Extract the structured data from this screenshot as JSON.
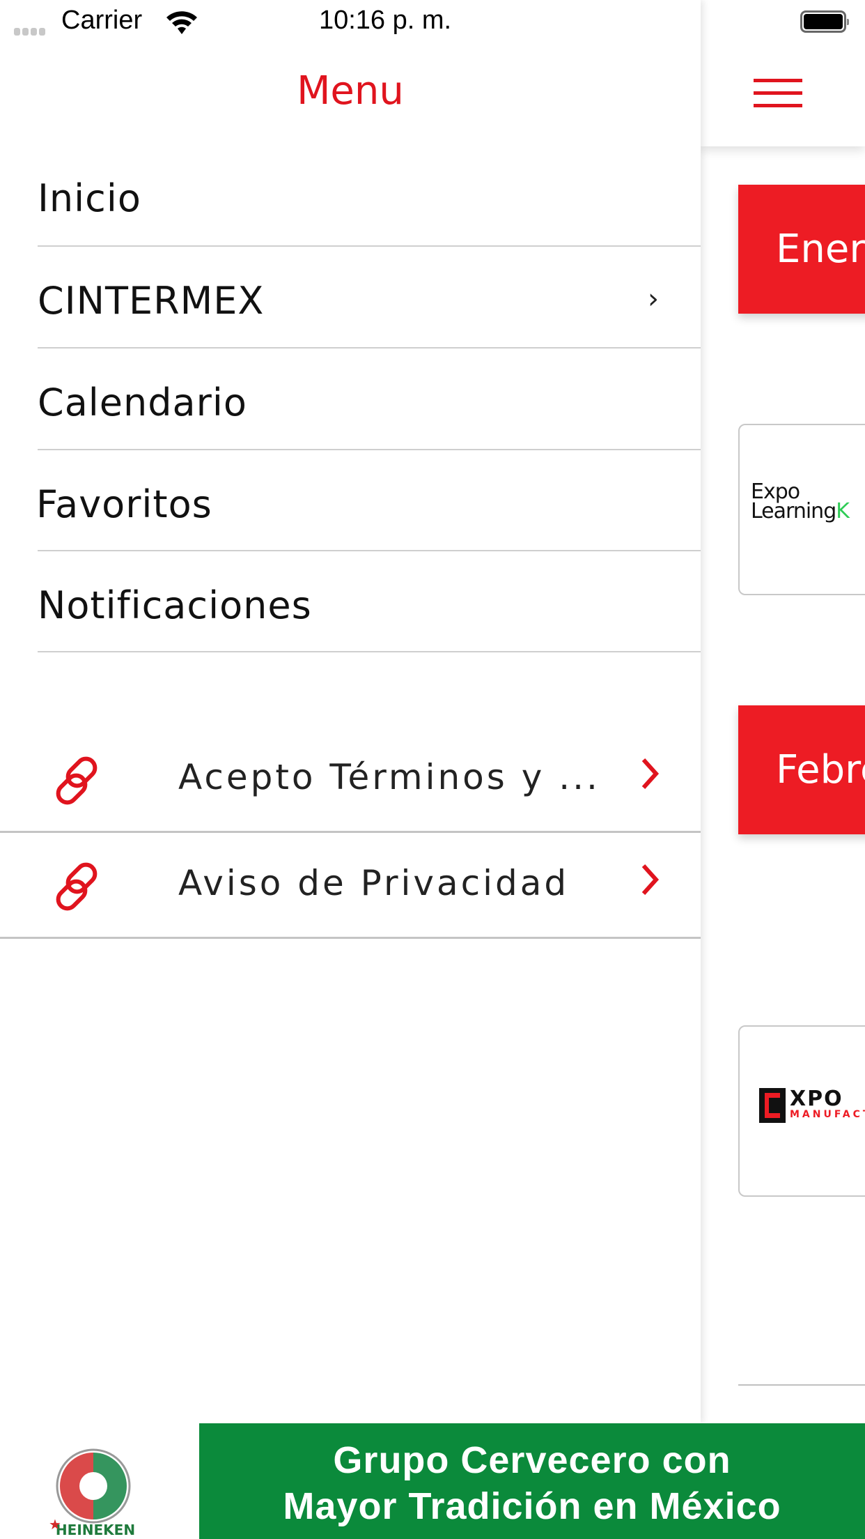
{
  "status_bar": {
    "carrier": "Carrier",
    "time": "10:16 p. m.",
    "signal_icon": "signal-dots-icon",
    "wifi_icon": "wifi-icon",
    "battery_icon": "battery-full-icon"
  },
  "drawer": {
    "title": "Menu",
    "items": [
      {
        "label": "Inicio",
        "has_chevron": false
      },
      {
        "label": "CINTERMEX",
        "has_chevron": true,
        "chevron": "›"
      },
      {
        "label": "Calendario",
        "has_chevron": false
      },
      {
        "label": "Favoritos",
        "has_chevron": false
      },
      {
        "label": "Notificaciones",
        "has_chevron": false
      }
    ],
    "links": [
      {
        "label": "Acepto Términos y ...",
        "icon": "link-icon"
      },
      {
        "label": "Aviso de Privacidad",
        "icon": "link-icon"
      }
    ]
  },
  "content": {
    "menu_icon": "hamburger-icon",
    "months": [
      "Enero",
      "Febrero"
    ],
    "events": [
      {
        "logo_line1": "Expo",
        "logo_line2": "Learning",
        "logo_accent": "K"
      },
      {
        "logo_text": "XPO",
        "logo_sub": "MANUFACTURA"
      }
    ]
  },
  "banner": {
    "logo_label": "HEINEKEN",
    "ad_line1": "Grupo Cervecero con",
    "ad_line2": "Mayor Tradición en México"
  },
  "colors": {
    "accent_red": "#e0141e",
    "month_bar_red": "#ed1c24",
    "ad_green": "#0b8a3b"
  }
}
